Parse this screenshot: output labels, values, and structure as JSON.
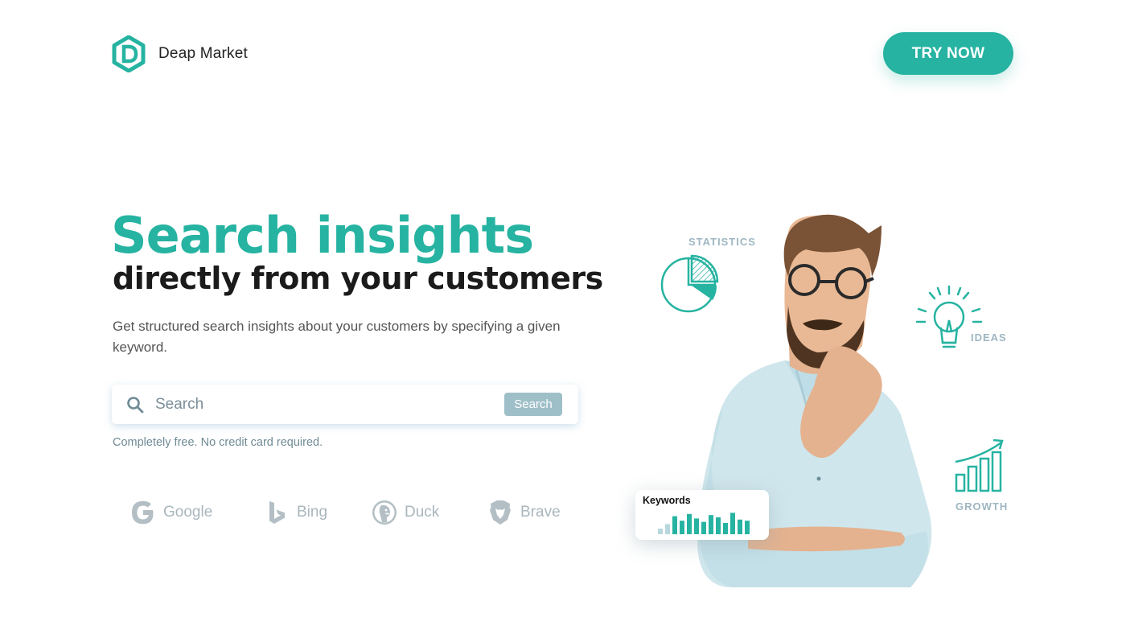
{
  "brand": {
    "name": "Deap Market",
    "accent": "#26b3a1"
  },
  "header": {
    "cta_label": "TRY NOW"
  },
  "hero": {
    "title": "Search insights",
    "subtitle": "directly from your customers",
    "description": "Get structured search insights about your customers by specifying a given keyword."
  },
  "search": {
    "placeholder": "Search",
    "button_label": "Search",
    "note": "Completely free. No credit card required."
  },
  "engines": [
    {
      "label": "Google",
      "icon": "google-icon"
    },
    {
      "label": "Bing",
      "icon": "bing-icon"
    },
    {
      "label": "Duck",
      "icon": "duckduckgo-icon"
    },
    {
      "label": "Brave",
      "icon": "brave-icon"
    }
  ],
  "illustration": {
    "statistics_label": "STATISTICS",
    "ideas_label": "IDEAS",
    "growth_label": "GROWTH",
    "keywords_card_title": "Keywords",
    "keyword_bars": [
      0.25,
      0.45,
      0.8,
      0.6,
      0.9,
      0.7,
      0.55,
      0.85,
      0.75,
      0.5,
      0.95,
      0.65,
      0.6
    ]
  }
}
